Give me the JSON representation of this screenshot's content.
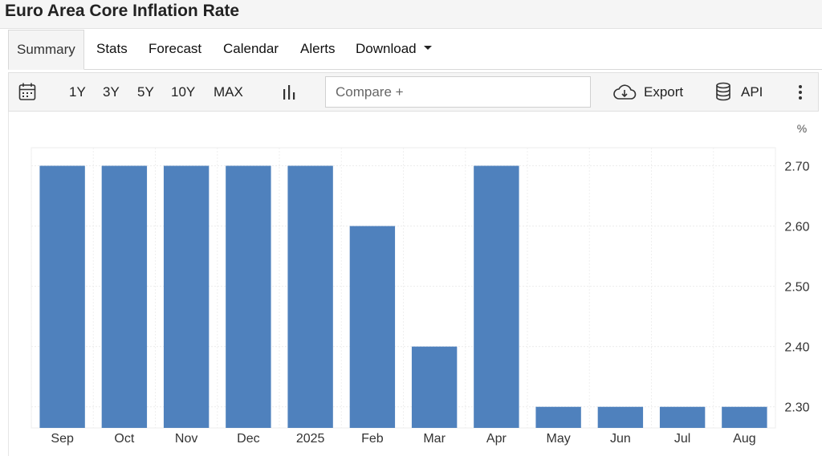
{
  "header": {
    "title": "Euro Area Core Inflation Rate"
  },
  "tabs": [
    {
      "label": "Summary"
    },
    {
      "label": "Stats"
    },
    {
      "label": "Forecast"
    },
    {
      "label": "Calendar"
    },
    {
      "label": "Alerts"
    },
    {
      "label": "Download"
    }
  ],
  "toolbar": {
    "ranges": [
      "1Y",
      "3Y",
      "5Y",
      "10Y",
      "MAX"
    ],
    "compare_placeholder": "Compare +",
    "export_label": "Export",
    "api_label": "API",
    "icons": [
      "calendar-icon",
      "bar-chart-icon",
      "cloud-download-icon",
      "database-icon",
      "more-vertical-icon"
    ]
  },
  "chart_data": {
    "type": "bar",
    "unit": "%",
    "categories": [
      "Sep",
      "Oct",
      "Nov",
      "Dec",
      "2025",
      "Feb",
      "Mar",
      "Apr",
      "May",
      "Jun",
      "Jul",
      "Aug"
    ],
    "values": [
      2.7,
      2.7,
      2.7,
      2.7,
      2.7,
      2.6,
      2.4,
      2.7,
      2.3,
      2.3,
      2.3,
      2.3
    ],
    "yticks": [
      "2.70",
      "2.60",
      "2.50",
      "2.40",
      "2.30"
    ],
    "ylim": [
      2.265,
      2.73
    ],
    "y_axis_side": "right",
    "grid": true,
    "bar_color": "#4f81bd"
  }
}
